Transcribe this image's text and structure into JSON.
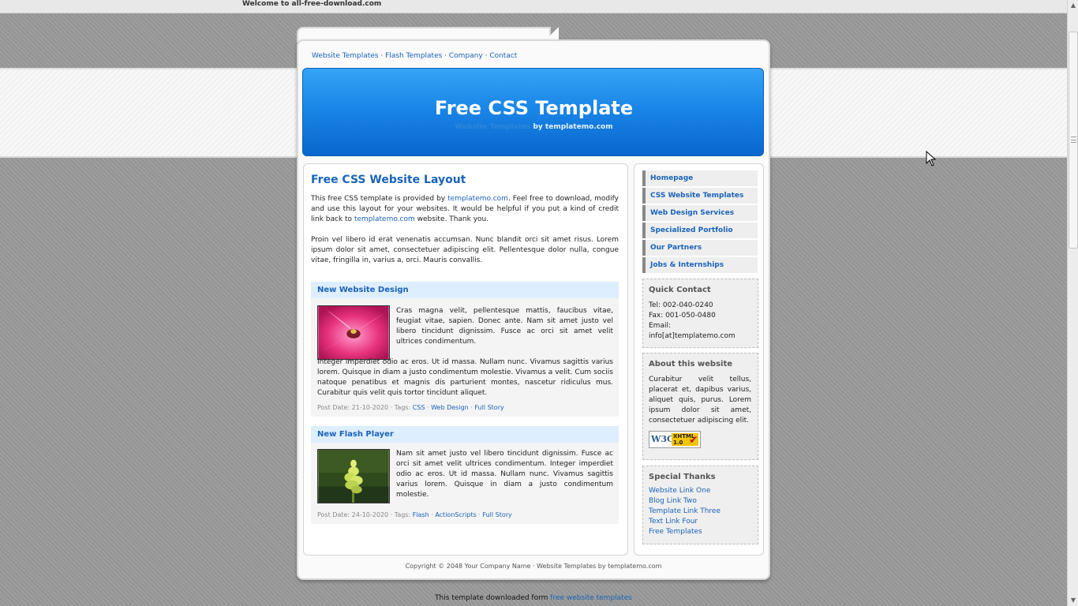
{
  "topbar": {
    "welcome": "Welcome to all-free-download.com"
  },
  "topnav": {
    "items": [
      "Website Templates",
      "Flash Templates",
      "Company",
      "Contact"
    ],
    "separator": " · "
  },
  "header": {
    "title": "Free CSS Template",
    "sub_faint": "Website Templates",
    "sub_main": " by templatemo.com"
  },
  "content": {
    "title": "Free CSS Website Layout",
    "intro": {
      "t1": "This free CSS template is provided by ",
      "link1": "templatemo.com",
      "t2": ". Feel free to download, modify and use this layout for your websites. It would be helpful if you put a kind of credit link back to ",
      "link2": "templatemo.com",
      "t3": " website. Thank you."
    },
    "para2": "Proin vel libero id erat venenatis accumsan. Nunc blandit orci sit amet risus. Lorem ipsum dolor sit amet, consectetuer adipiscing elit. Pellentesque dolor nulla, congue vitae, fringilla in, varius a, orci. Mauris convallis.",
    "posts": [
      {
        "title": "New Website Design",
        "text1": "Cras magna velit, pellentesque mattis, faucibus vitae, feugiat vitae, sapien. Donec ante. Nam sit amet justo vel libero tincidunt dignissim. Fusce ac orci sit amet velit ultrices condimentum.",
        "text2": "Integer imperdiet odio ac eros. Ut id massa. Nullam nunc. Vivamus sagittis varius lorem. Quisque in diam a justo condimentum molestie. Vivamus a velit. Cum sociis natoque penatibus et magnis dis parturient montes, nascetur ridiculus mus. Curabitur quis velit quis tortor tincidunt aliquet.",
        "meta_prefix": "Post Date: 21-10-2020 · Tags: ",
        "tag1": "CSS",
        "tag2": "Web Design",
        "more": "Full Story"
      },
      {
        "title": "New Flash Player",
        "text1": "Nam sit amet justo vel libero tincidunt dignissim. Fusce ac orci sit amet velit ultrices condimentum. Integer imperdiet odio ac eros. Ut id massa. Nullam nunc. Vivamus sagittis varius lorem. Quisque in diam a justo condimentum molestie.",
        "meta_prefix": "Post Date: 24-10-2020 · Tags: ",
        "tag1": "Flash",
        "tag2": "ActionScripts",
        "more": "Full Story"
      }
    ],
    "sep": " · "
  },
  "sidebar": {
    "menu": [
      "Homepage",
      "CSS Website Templates",
      "Web Design Services",
      "Specialized Portfolio",
      "Our Partners",
      "Jobs & Internships"
    ],
    "quick_contact": {
      "title": "Quick Contact",
      "tel": "Tel: 002-040-0240",
      "fax": "Fax: 001-050-0480",
      "email": "Email: info[at]templatemo.com"
    },
    "about": {
      "title": "About this website",
      "text": "Curabitur velit tellus, placerat et, dapibus varius, aliquet quis, purus. Lorem ipsum dolor sit amet, consectetuer adipiscing elit.",
      "badge_w3c": "W3C",
      "badge_xhtml": "XHTML",
      "badge_version": "1.0"
    },
    "thanks": {
      "title": "Special Thanks",
      "links": [
        "Website Link One",
        "Blog Link Two",
        "Template Link Three",
        "Text Link Four",
        "Free Templates"
      ]
    }
  },
  "footer": {
    "copyright": "Copyright © 2048 Your Company Name · Website Templates by templatemo.com",
    "note_prefix": "This template downloaded form ",
    "note_link": "free website templates"
  },
  "colors": {
    "link": "#1a63b8",
    "header_blue": "#1a86e8",
    "post_head_bg": "#ddeeff"
  }
}
